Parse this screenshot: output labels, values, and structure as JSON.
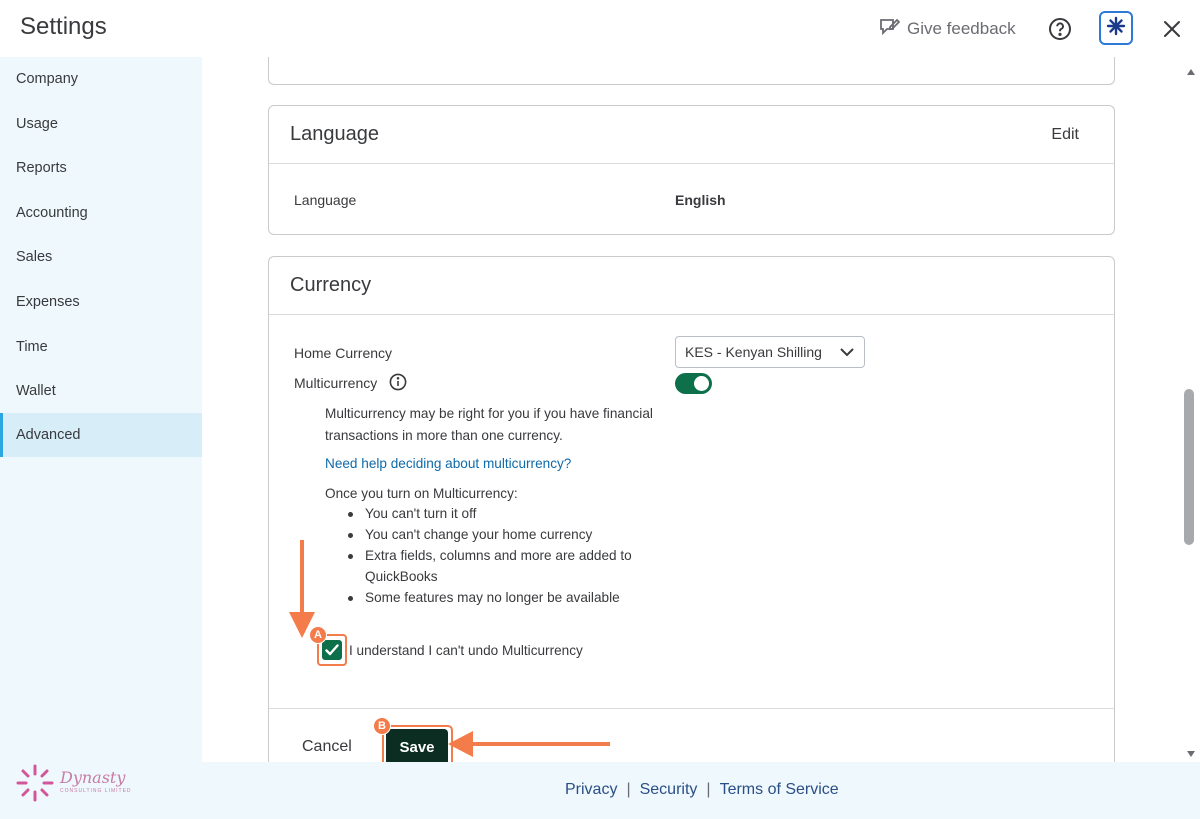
{
  "header": {
    "title": "Settings",
    "feedback_label": "Give feedback"
  },
  "sidebar": {
    "items": [
      {
        "label": "Company"
      },
      {
        "label": "Usage"
      },
      {
        "label": "Reports"
      },
      {
        "label": "Accounting"
      },
      {
        "label": "Sales"
      },
      {
        "label": "Expenses"
      },
      {
        "label": "Time"
      },
      {
        "label": "Wallet"
      },
      {
        "label": "Advanced",
        "active": true
      }
    ]
  },
  "language_section": {
    "title": "Language",
    "edit_label": "Edit",
    "field_label": "Language",
    "field_value": "English"
  },
  "currency_section": {
    "title": "Currency",
    "home_currency_label": "Home Currency",
    "home_currency_value": "KES - Kenyan Shilling",
    "multicurrency_label": "Multicurrency",
    "multicurrency_enabled": true,
    "description_line1": "Multicurrency may be right for you if you have financial",
    "description_line2": "transactions in more than one currency.",
    "help_link": "Need help deciding about multicurrency?",
    "once_on_label": "Once you turn on Multicurrency:",
    "bullets": [
      "You can't turn it off",
      "You can't change your home currency",
      "Extra fields, columns and more are added to",
      "QuickBooks",
      "Some features may no longer be available"
    ],
    "confirm_label": "I understand I can't undo Multicurrency",
    "confirm_checked": true,
    "cancel_label": "Cancel",
    "save_label": "Save"
  },
  "annotations": {
    "badge_a": "A",
    "badge_b": "B",
    "accent_color": "#f37c4a"
  },
  "footer": {
    "privacy": "Privacy",
    "security": "Security",
    "terms": "Terms of Service",
    "separator": "|",
    "logo_name": "Dynasty",
    "logo_sub": "CONSULTING LIMITED"
  },
  "colors": {
    "primary_green": "#0d704a",
    "save_bg": "#0c2d21",
    "sidebar_bg": "#eff8fd",
    "link_blue": "#0f6aa8"
  }
}
